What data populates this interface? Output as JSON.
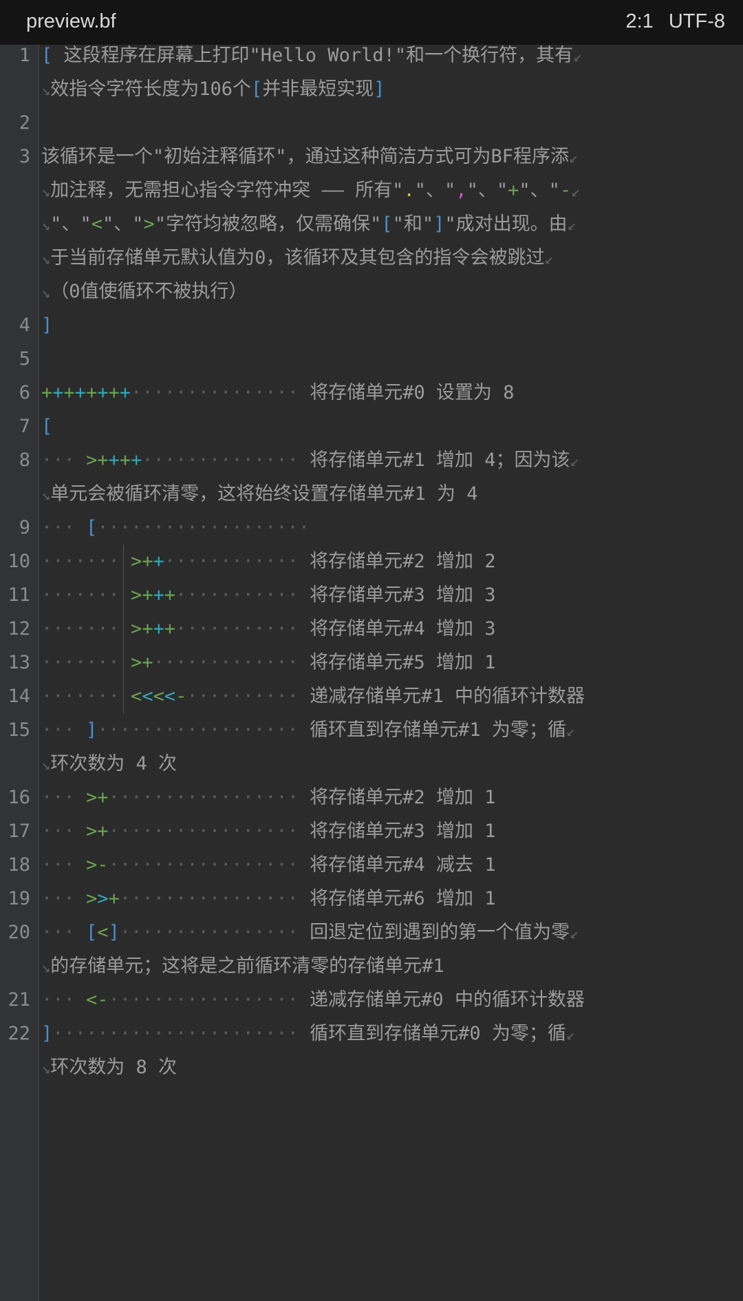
{
  "header": {
    "title": "preview.bf",
    "cursor": "2:1",
    "encoding": "UTF-8"
  },
  "colors": {
    "background": "#2b2b2b",
    "gutter": "#313335",
    "bracket": "#4b8fcb",
    "op_green": "#6aa34f",
    "op_cyan": "#2fa7b8",
    "comment": "#9b9b9b"
  },
  "lines": [
    {
      "n": "1",
      "rows": [
        [
          [
            "op",
            "["
          ],
          [
            "txt",
            " 这段程序在屏幕上打印\"Hello World!\"和一个换行符，其有"
          ],
          [
            "we",
            "↙"
          ]
        ],
        [
          [
            "ws",
            "↘"
          ],
          [
            "txt",
            "效指令字符长度为106个"
          ],
          [
            "op",
            "["
          ],
          [
            "txt",
            "并非最短实现"
          ],
          [
            "op",
            "]"
          ]
        ]
      ]
    },
    {
      "n": "2",
      "rows": [
        []
      ]
    },
    {
      "n": "3",
      "rows": [
        [
          [
            "txt",
            "该循环是一个\"初始注释循环\"，通过这种简洁方式可为BF程序添"
          ],
          [
            "we",
            "↙"
          ]
        ],
        [
          [
            "ws",
            "↘"
          ],
          [
            "txt",
            "加注释，无需担心指令字符冲突 —— 所有\""
          ],
          [
            "op",
            "."
          ],
          [
            "txt",
            "\"、\""
          ],
          [
            "op",
            ","
          ],
          [
            "txt",
            "\"、\""
          ],
          [
            "op",
            "+"
          ],
          [
            "txt",
            "\"、\""
          ],
          [
            "op",
            "-"
          ],
          [
            "we",
            "↙"
          ]
        ],
        [
          [
            "ws",
            "↘"
          ],
          [
            "txt",
            "\"、\""
          ],
          [
            "op",
            "<"
          ],
          [
            "txt",
            "\"、\""
          ],
          [
            "op",
            ">"
          ],
          [
            "txt",
            "\"字符均被忽略，仅需确保\""
          ],
          [
            "op",
            "["
          ],
          [
            "txt",
            "\"和\""
          ],
          [
            "op",
            "]"
          ],
          [
            "txt",
            "\"成对出现。由"
          ],
          [
            "we",
            "↙"
          ]
        ],
        [
          [
            "ws",
            "↘"
          ],
          [
            "txt",
            "于当前存储单元默认值为0，该循环及其包含的指令会被跳过"
          ],
          [
            "we",
            "↙"
          ]
        ],
        [
          [
            "ws",
            "↘"
          ],
          [
            "txt",
            "（0值使循环不被执行）"
          ]
        ]
      ]
    },
    {
      "n": "4",
      "rows": [
        [
          [
            "op",
            "]"
          ]
        ]
      ]
    },
    {
      "n": "5",
      "rows": [
        []
      ]
    },
    {
      "n": "6",
      "rows": [
        [
          [
            "op",
            "++++++++"
          ],
          [
            "dots",
            "··············· "
          ],
          [
            "txt",
            "将存储单元#0 设置为 8"
          ]
        ]
      ]
    },
    {
      "n": "7",
      "rows": [
        [
          [
            "op",
            "["
          ]
        ]
      ]
    },
    {
      "n": "8",
      "rows": [
        [
          [
            "dots",
            "··· "
          ],
          [
            "op",
            ">++++"
          ],
          [
            "dots",
            "·············· "
          ],
          [
            "txt",
            "将存储单元#1 增加 4；因为该"
          ],
          [
            "we",
            "↙"
          ]
        ],
        [
          [
            "ws",
            "↘"
          ],
          [
            "txt",
            "单元会被循环清零，这将始终设置存储单元#1 为 4"
          ]
        ]
      ]
    },
    {
      "n": "9",
      "rows": [
        [
          [
            "dots",
            "··· "
          ],
          [
            "op",
            "["
          ],
          [
            "dots",
            "···················"
          ]
        ]
      ]
    },
    {
      "n": "10",
      "rows": [
        [
          [
            "dots",
            "······· "
          ],
          [
            "op",
            ">++"
          ],
          [
            "dots",
            "············ "
          ],
          [
            "txt",
            "将存储单元#2 增加 2"
          ]
        ]
      ]
    },
    {
      "n": "11",
      "rows": [
        [
          [
            "dots",
            "······· "
          ],
          [
            "op",
            ">+++"
          ],
          [
            "dots",
            "··········· "
          ],
          [
            "txt",
            "将存储单元#3 增加 3"
          ]
        ]
      ]
    },
    {
      "n": "12",
      "rows": [
        [
          [
            "dots",
            "······· "
          ],
          [
            "op",
            ">+++"
          ],
          [
            "dots",
            "··········· "
          ],
          [
            "txt",
            "将存储单元#4 增加 3"
          ]
        ]
      ]
    },
    {
      "n": "13",
      "rows": [
        [
          [
            "dots",
            "······· "
          ],
          [
            "op",
            ">+"
          ],
          [
            "dots",
            "············· "
          ],
          [
            "txt",
            "将存储单元#5 增加 1"
          ]
        ]
      ]
    },
    {
      "n": "14",
      "rows": [
        [
          [
            "dots",
            "······· "
          ],
          [
            "op",
            "<<<<-"
          ],
          [
            "dots",
            "·········· "
          ],
          [
            "txt",
            "递减存储单元#1 中的循环计数器"
          ]
        ]
      ]
    },
    {
      "n": "15",
      "rows": [
        [
          [
            "dots",
            "··· "
          ],
          [
            "op",
            "]"
          ],
          [
            "dots",
            "·················· "
          ],
          [
            "txt",
            "循环直到存储单元#1 为零；循"
          ],
          [
            "we",
            "↙"
          ]
        ],
        [
          [
            "ws",
            "↘"
          ],
          [
            "txt",
            "环次数为 4 次"
          ]
        ]
      ]
    },
    {
      "n": "16",
      "rows": [
        [
          [
            "dots",
            "··· "
          ],
          [
            "op",
            ">+"
          ],
          [
            "dots",
            "················· "
          ],
          [
            "txt",
            "将存储单元#2 增加 1"
          ]
        ]
      ]
    },
    {
      "n": "17",
      "rows": [
        [
          [
            "dots",
            "··· "
          ],
          [
            "op",
            ">+"
          ],
          [
            "dots",
            "················· "
          ],
          [
            "txt",
            "将存储单元#3 增加 1"
          ]
        ]
      ]
    },
    {
      "n": "18",
      "rows": [
        [
          [
            "dots",
            "··· "
          ],
          [
            "op",
            ">-"
          ],
          [
            "dots",
            "················· "
          ],
          [
            "txt",
            "将存储单元#4 减去 1"
          ]
        ]
      ]
    },
    {
      "n": "19",
      "rows": [
        [
          [
            "dots",
            "··· "
          ],
          [
            "op",
            ">>+"
          ],
          [
            "dots",
            "················ "
          ],
          [
            "txt",
            "将存储单元#6 增加 1"
          ]
        ]
      ]
    },
    {
      "n": "20",
      "rows": [
        [
          [
            "dots",
            "··· "
          ],
          [
            "op",
            "[<]"
          ],
          [
            "dots",
            "················ "
          ],
          [
            "txt",
            "回退定位到遇到的第一个值为零"
          ],
          [
            "we",
            "↙"
          ]
        ],
        [
          [
            "ws",
            "↘"
          ],
          [
            "txt",
            "的存储单元；这将是之前循环清零的存储单元#1"
          ]
        ]
      ]
    },
    {
      "n": "21",
      "rows": [
        [
          [
            "dots",
            "··· "
          ],
          [
            "op",
            "<-"
          ],
          [
            "dots",
            "················· "
          ],
          [
            "txt",
            "递减存储单元#0 中的循环计数器"
          ]
        ]
      ]
    },
    {
      "n": "22",
      "rows": [
        [
          [
            "op",
            "]"
          ],
          [
            "dots",
            "······················ "
          ],
          [
            "txt",
            "循环直到存储单元#0 为零；循"
          ],
          [
            "we",
            "↙"
          ]
        ],
        [
          [
            "ws",
            "↘"
          ],
          [
            "txt",
            "环次数为 8 次"
          ]
        ]
      ]
    }
  ]
}
